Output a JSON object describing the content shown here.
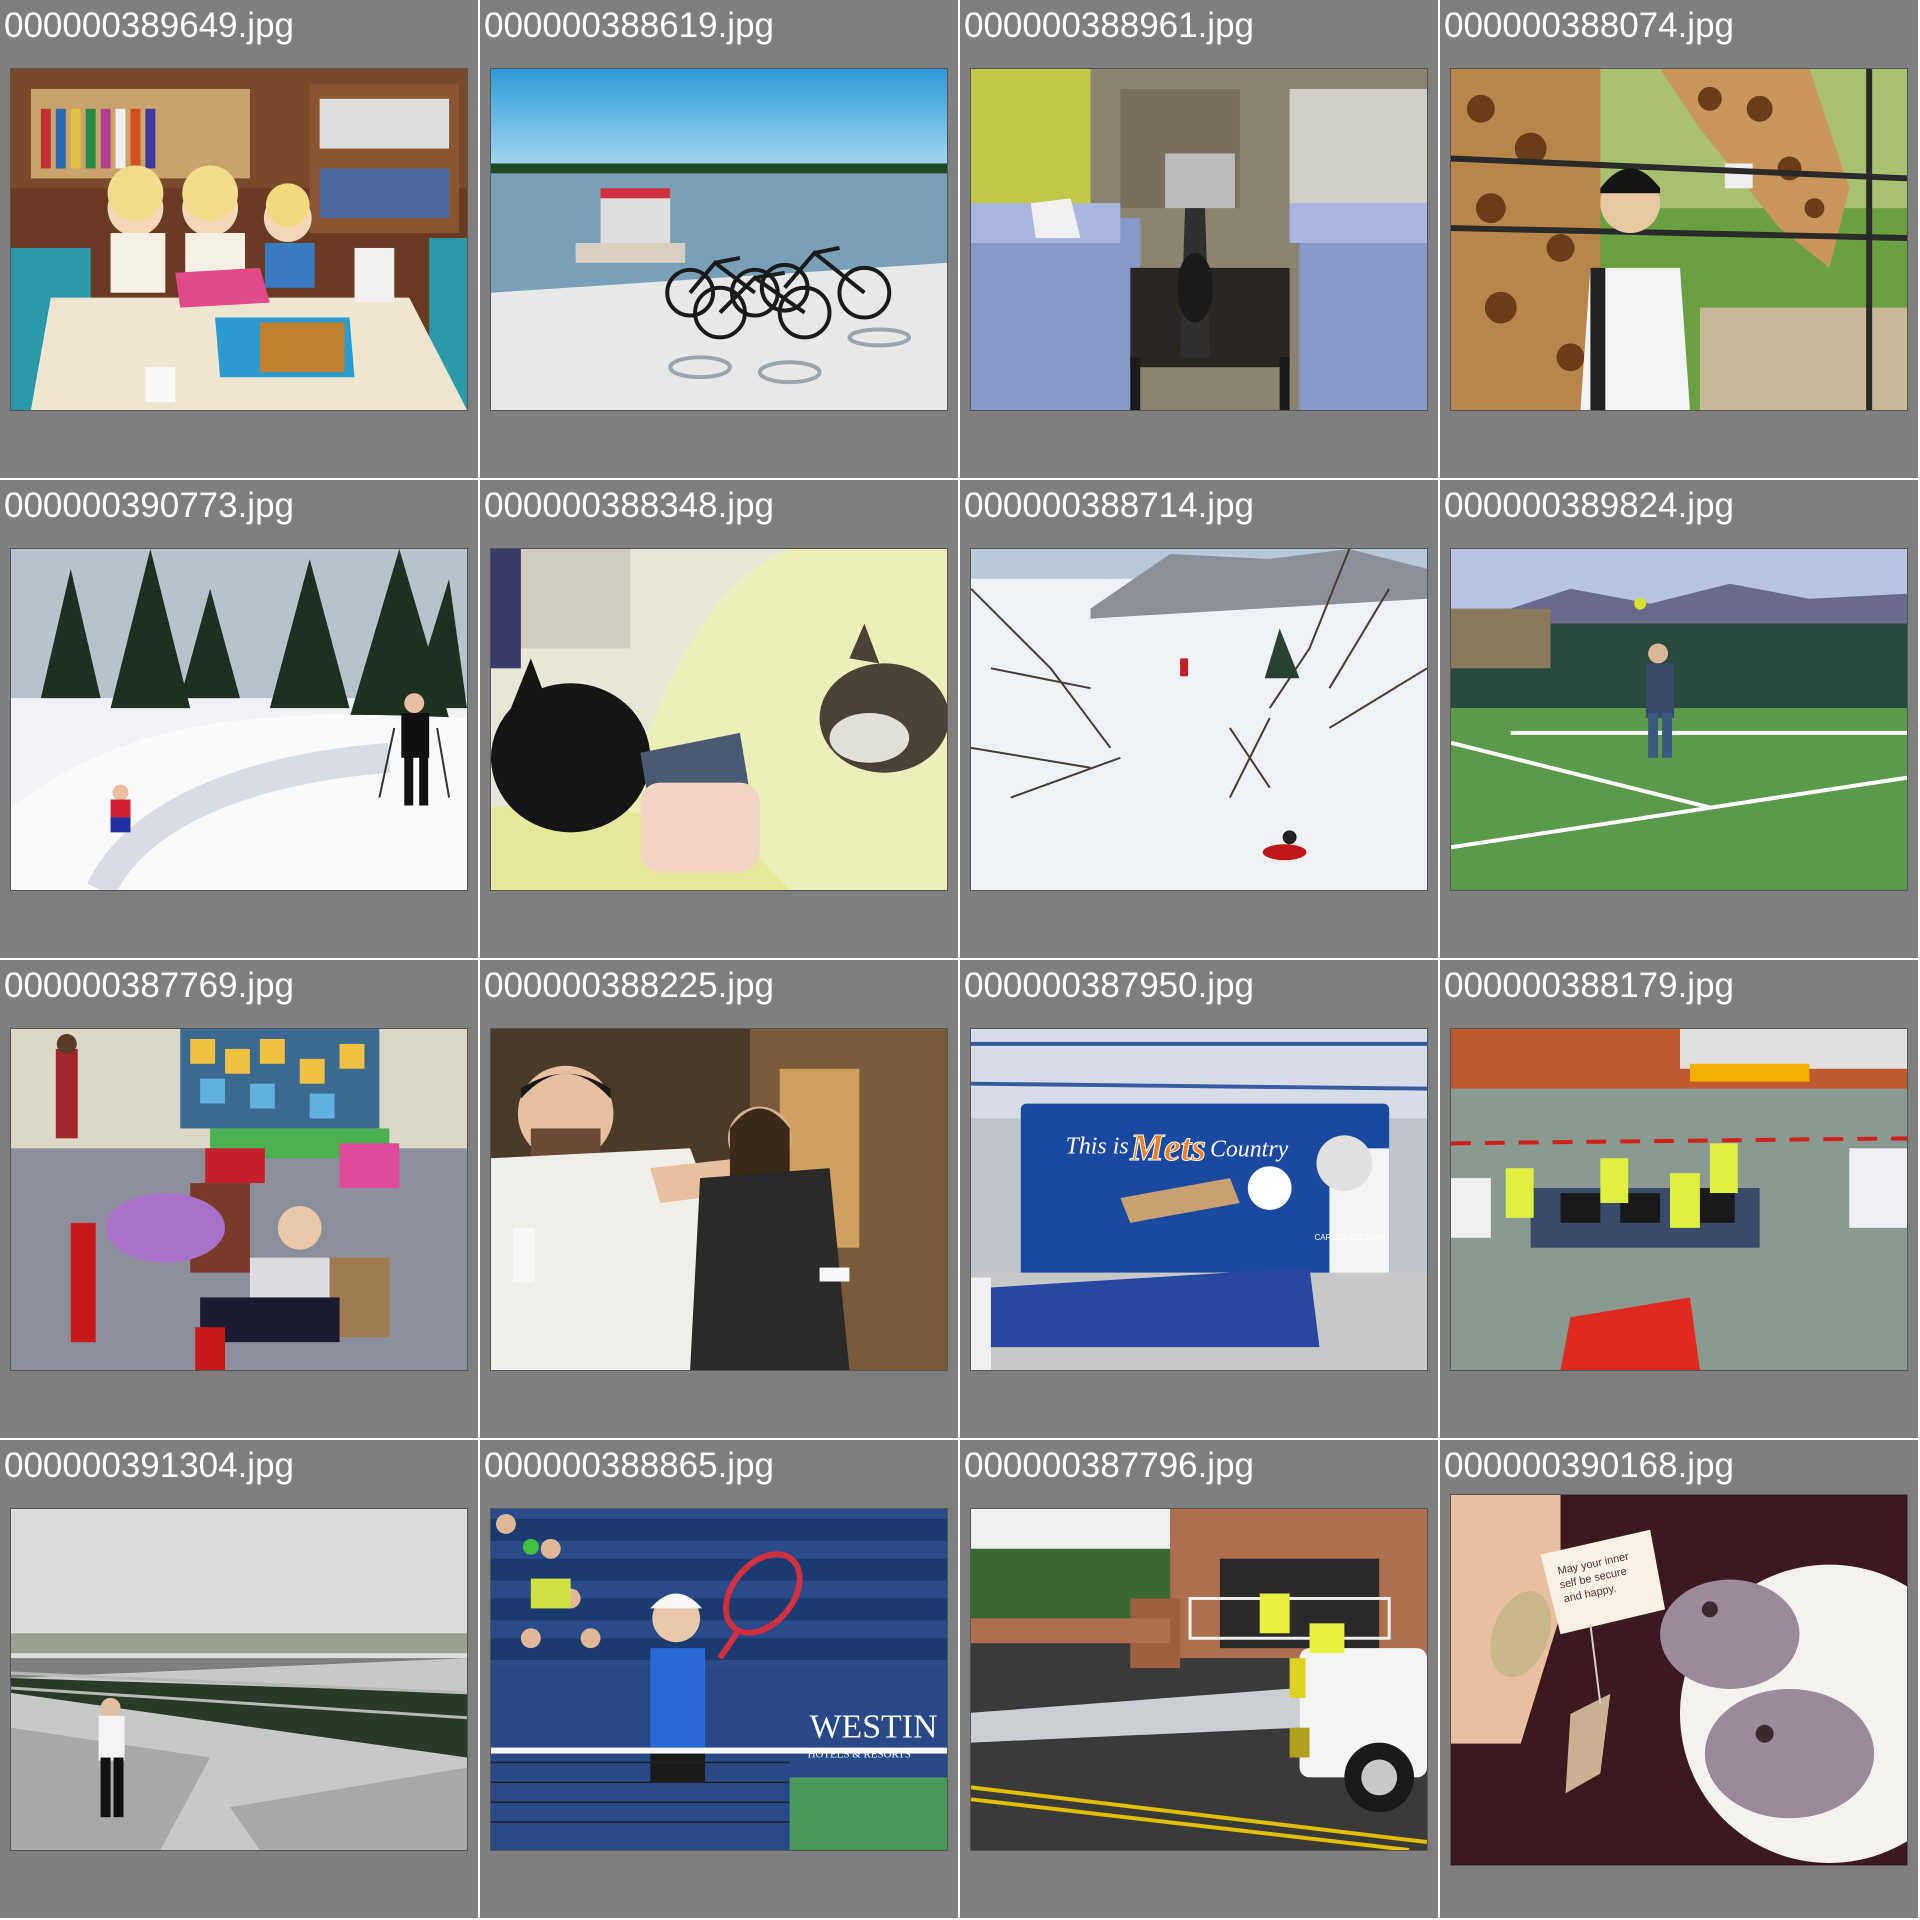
{
  "gallery": {
    "items": [
      {
        "filename": "000000389649.jpg",
        "scene": "kids-at-table"
      },
      {
        "filename": "000000388619.jpg",
        "scene": "bikes-on-beach"
      },
      {
        "filename": "000000388961.jpg",
        "scene": "living-room"
      },
      {
        "filename": "000000388074.jpg",
        "scene": "giraffe-and-man"
      },
      {
        "filename": "000000390773.jpg",
        "scene": "cross-country-ski"
      },
      {
        "filename": "000000388348.jpg",
        "scene": "cats-on-blanket"
      },
      {
        "filename": "000000388714.jpg",
        "scene": "snowy-valley"
      },
      {
        "filename": "000000389824.jpg",
        "scene": "tennis-serve"
      },
      {
        "filename": "000000387769.jpg",
        "scene": "airport-kids-luggage"
      },
      {
        "filename": "000000388225.jpg",
        "scene": "wii-players"
      },
      {
        "filename": "000000387950.jpg",
        "scene": "mets-trailer"
      },
      {
        "filename": "000000388179.jpg",
        "scene": "airport-baggage-crew"
      },
      {
        "filename": "000000391304.jpg",
        "scene": "man-on-promenade"
      },
      {
        "filename": "000000388865.jpg",
        "scene": "tennis-player"
      },
      {
        "filename": "000000387796.jpg",
        "scene": "fire-hydrant-spray"
      },
      {
        "filename": "000000390168.jpg",
        "scene": "tea-tag-cookies"
      }
    ]
  },
  "embedded_text": {
    "mets_trailer": {
      "line1": "This is",
      "brand": "Mets",
      "line2": "Country",
      "player": "CARLOS BELTRAN"
    },
    "tennis_sign": {
      "brand": "WESTIN",
      "sub": "HOTELS & RESORTS"
    },
    "tea_tag": {
      "line1": "May your inner",
      "line2": "self be secure",
      "line3": "and happy."
    }
  },
  "colors": {
    "tile_background": "#7f7f7f",
    "label_text": "#ffffff",
    "page_background": "#ffffff"
  }
}
